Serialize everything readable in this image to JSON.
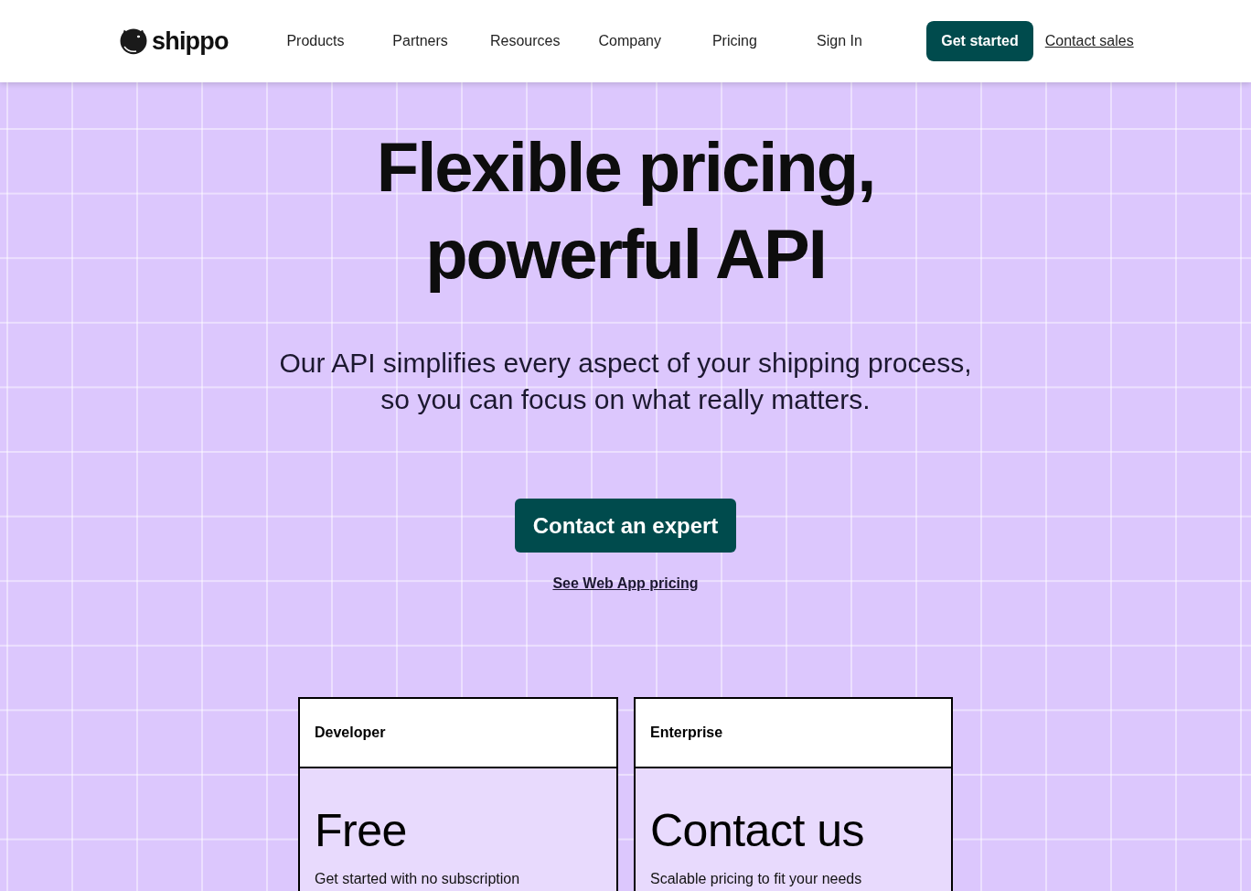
{
  "header": {
    "logo": {
      "text": "shippo"
    },
    "nav": [
      {
        "label": "Products"
      },
      {
        "label": "Partners"
      },
      {
        "label": "Resources"
      },
      {
        "label": "Company"
      },
      {
        "label": "Pricing"
      },
      {
        "label": "Sign In"
      }
    ],
    "actions": [
      {
        "kind": "button",
        "label": "Get started"
      },
      {
        "kind": "link",
        "label": "Contact sales"
      }
    ]
  },
  "hero": {
    "title": "Flexible pricing, powerful API",
    "subtitle": "Our API simplifies every aspect of your shipping process, so you can focus on what really matters.",
    "cta": {
      "label": "Contact an expert"
    },
    "secondary_link": {
      "label": "See Web App pricing"
    }
  },
  "plans": [
    {
      "name": "Developer",
      "price": "Free",
      "description": "Get started with no subscription"
    },
    {
      "name": "Enterprise",
      "price": "Contact us",
      "description": "Scalable pricing to fit your needs"
    }
  ]
}
